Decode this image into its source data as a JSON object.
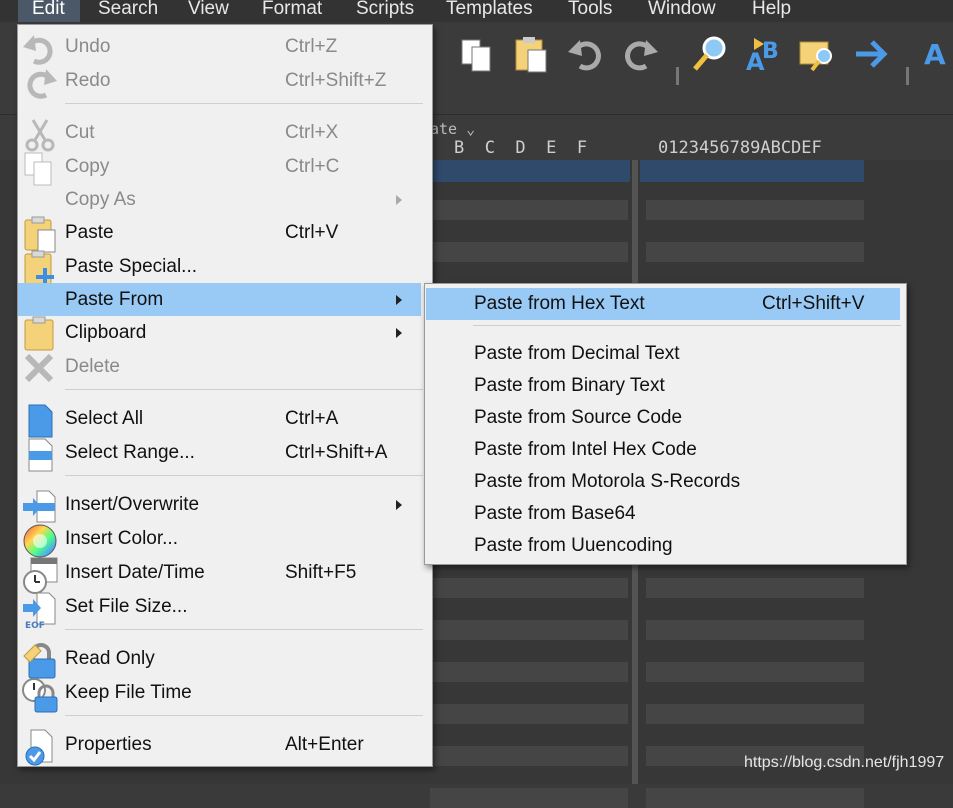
{
  "menubar": {
    "items": [
      {
        "label": "Edit",
        "active": true
      },
      {
        "label": "Search"
      },
      {
        "label": "View"
      },
      {
        "label": "Format"
      },
      {
        "label": "Scripts"
      },
      {
        "label": "Templates"
      },
      {
        "label": "Tools"
      },
      {
        "label": "Window"
      },
      {
        "label": "Help"
      }
    ]
  },
  "hexview": {
    "template_label": "ate",
    "column_headers": "B  C  D  E  F",
    "ascii_header": "0123456789ABCDEF"
  },
  "edit_menu": {
    "items": [
      {
        "label": "Undo",
        "shortcut": "Ctrl+Z",
        "disabled": true,
        "icon": "undo-icon"
      },
      {
        "label": "Redo",
        "shortcut": "Ctrl+Shift+Z",
        "disabled": true,
        "icon": "redo-icon"
      },
      {
        "label": "Cut",
        "shortcut": "Ctrl+X",
        "disabled": true,
        "icon": "cut-icon"
      },
      {
        "label": "Copy",
        "shortcut": "Ctrl+C",
        "disabled": true,
        "icon": "copy-icon"
      },
      {
        "label": "Copy As",
        "shortcut": "",
        "disabled": true,
        "submenu": true
      },
      {
        "label": "Paste",
        "shortcut": "Ctrl+V",
        "icon": "paste-icon"
      },
      {
        "label": "Paste Special...",
        "shortcut": "",
        "icon": "paste-special-icon"
      },
      {
        "label": "Paste From",
        "shortcut": "",
        "submenu": true,
        "highlighted": true
      },
      {
        "label": "Clipboard",
        "shortcut": "",
        "submenu": true,
        "icon": "clipboard-icon"
      },
      {
        "label": "Delete",
        "shortcut": "",
        "disabled": true,
        "icon": "delete-icon"
      },
      {
        "label": "Select All",
        "shortcut": "Ctrl+A",
        "icon": "select-all-icon"
      },
      {
        "label": "Select Range...",
        "shortcut": "Ctrl+Shift+A",
        "icon": "select-range-icon"
      },
      {
        "label": "Insert/Overwrite",
        "shortcut": "",
        "submenu": true,
        "icon": "insert-overwrite-icon"
      },
      {
        "label": "Insert Color...",
        "shortcut": "",
        "icon": "color-wheel-icon"
      },
      {
        "label": "Insert Date/Time",
        "shortcut": "Shift+F5",
        "icon": "calendar-clock-icon"
      },
      {
        "label": "Set File Size...",
        "shortcut": "",
        "icon": "file-size-icon"
      },
      {
        "label": "Read Only",
        "shortcut": "",
        "icon": "lock-icon"
      },
      {
        "label": "Keep File Time",
        "shortcut": "",
        "icon": "lock-clock-icon"
      },
      {
        "label": "Properties",
        "shortcut": "Alt+Enter",
        "icon": "properties-icon"
      }
    ]
  },
  "paste_from_submenu": {
    "items": [
      {
        "label": "Paste from Hex Text",
        "shortcut": "Ctrl+Shift+V",
        "highlighted": true
      },
      {
        "label": "Paste from Decimal Text",
        "shortcut": ""
      },
      {
        "label": "Paste from Binary Text",
        "shortcut": ""
      },
      {
        "label": "Paste from Source Code",
        "shortcut": ""
      },
      {
        "label": "Paste from Intel Hex Code",
        "shortcut": ""
      },
      {
        "label": "Paste from Motorola S-Records",
        "shortcut": ""
      },
      {
        "label": "Paste from Base64",
        "shortcut": ""
      },
      {
        "label": "Paste from Uuencoding",
        "shortcut": ""
      }
    ]
  },
  "watermark": "https://blog.csdn.net/fjh1997",
  "colors": {
    "menu_bg": "#f0f0f0",
    "highlight": "#99c9f5",
    "editor_bg": "#373737",
    "selection_row": "#2f4a6b"
  }
}
